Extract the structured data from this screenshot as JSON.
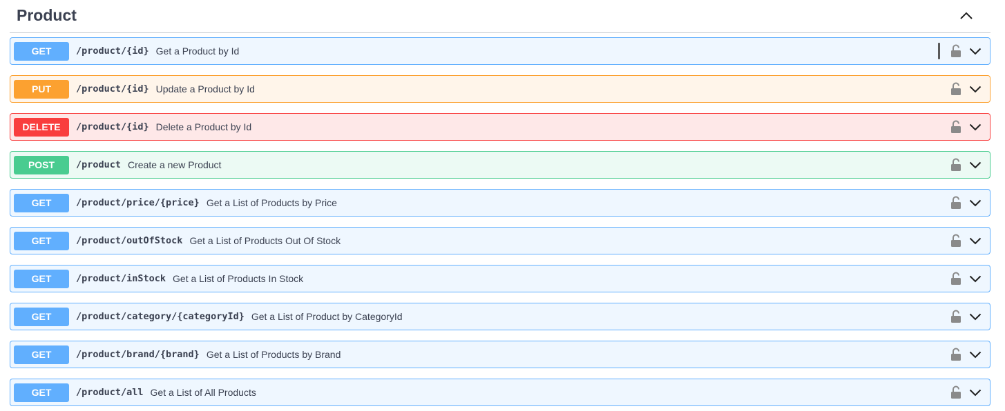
{
  "section": {
    "title": "Product",
    "collapse_icon": "chevron-up-icon"
  },
  "operations": [
    {
      "method": "GET",
      "kind": "get",
      "path": "/product/{id}",
      "summary": "Get a Product by Id",
      "focused": true
    },
    {
      "method": "PUT",
      "kind": "put",
      "path": "/product/{id}",
      "summary": "Update a Product by Id"
    },
    {
      "method": "DELETE",
      "kind": "delete",
      "path": "/product/{id}",
      "summary": "Delete a Product by Id"
    },
    {
      "method": "POST",
      "kind": "post",
      "path": "/product",
      "summary": "Create a new Product"
    },
    {
      "method": "GET",
      "kind": "get",
      "path": "/product/price/{price}",
      "summary": "Get a List of Products by Price"
    },
    {
      "method": "GET",
      "kind": "get",
      "path": "/product/outOfStock",
      "summary": "Get a List of Products Out Of Stock"
    },
    {
      "method": "GET",
      "kind": "get",
      "path": "/product/inStock",
      "summary": "Get a List of Products In Stock"
    },
    {
      "method": "GET",
      "kind": "get",
      "path": "/product/category/{categoryId}",
      "summary": "Get a List of Product by CategoryId"
    },
    {
      "method": "GET",
      "kind": "get",
      "path": "/product/brand/{brand}",
      "summary": "Get a List of Products by Brand"
    },
    {
      "method": "GET",
      "kind": "get",
      "path": "/product/all",
      "summary": "Get a List of All Products"
    }
  ],
  "colors": {
    "get": "#61affe",
    "put": "#fca130",
    "delete": "#f93e3e",
    "post": "#49cc90",
    "text": "#3b4151",
    "icon": "#8a8a8a"
  },
  "icons": {
    "lock": "unlocked-lock-icon",
    "expand": "chevron-down-icon"
  }
}
